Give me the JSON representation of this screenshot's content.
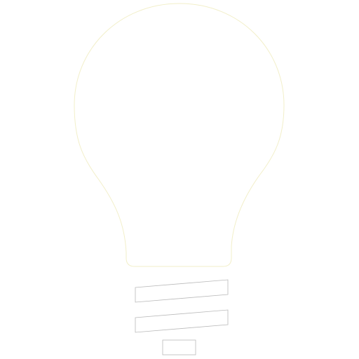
{
  "icon": {
    "name": "lightbulb-icon",
    "bulb_outline_color": "#f2efc9",
    "base_outline_color": "#b9b9b9",
    "background_color": "#ffffff"
  }
}
